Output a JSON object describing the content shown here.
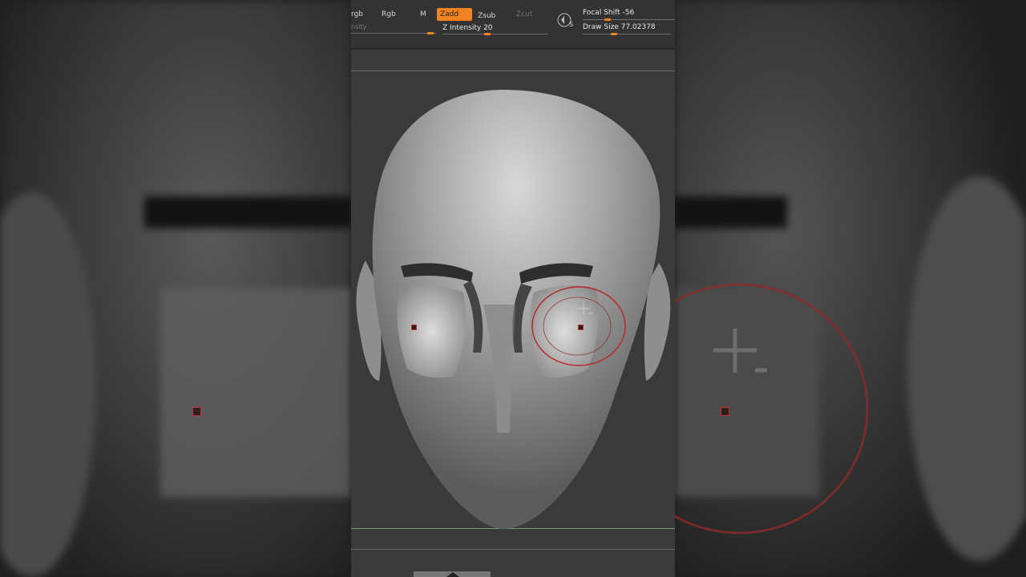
{
  "toolbar": {
    "rgb_mode": "rgb",
    "rgb": "Rgb",
    "m": "M",
    "zadd": "Zadd",
    "zsub": "Zsub",
    "zcut": "Zcut",
    "intensity_partial": "nsity",
    "z_intensity_label": "Z Intensity",
    "z_intensity_value": "20",
    "focal_shift_label": "Focal Shift",
    "focal_shift_value": "-56",
    "draw_size_label": "Draw Size",
    "draw_size_value": "77.02378",
    "symmetry_icon_letter": "S"
  },
  "colors": {
    "accent": "#f0831f",
    "brush_ring": "#b82a2a",
    "bg": "#3a3a3a"
  },
  "icons": {
    "symmetry": "symmetry-icon",
    "cursor": "crosshair-icon"
  }
}
